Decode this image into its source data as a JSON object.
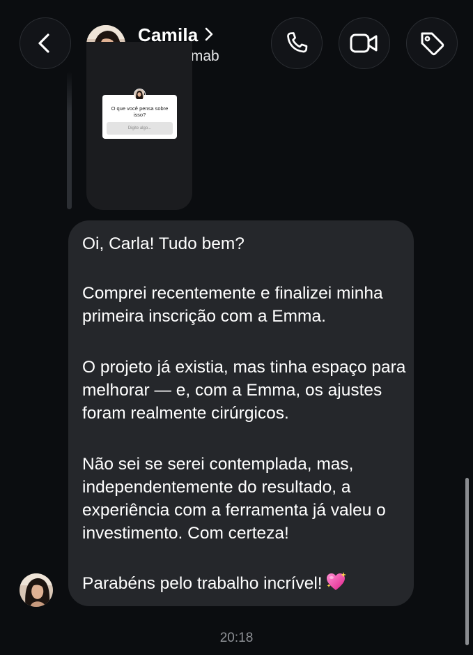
{
  "header": {
    "contact_name": "Camila",
    "username": "camila.limab",
    "icons": {
      "back": "chevron-left-icon",
      "call": "phone-icon",
      "video": "video-camera-icon",
      "tag": "tag-icon",
      "profile_link": "chevron-right-icon"
    }
  },
  "story_reply": {
    "question": "O que você pensa sobre isso?",
    "answer_placeholder": "Digite algo..."
  },
  "message": {
    "paragraphs": [
      "Oi, Carla! Tudo bem?",
      "Comprei recentemente e finalizei minha primeira inscrição com a Emma.",
      "O projeto já existia, mas tinha espaço para melhorar — e, com a Emma, os ajustes foram realmente cirúrgicos.",
      "Não sei se serei contemplada, mas, independentemente do resultado, a experiência com a ferramenta já valeu o investimento. Com certeza!",
      "Parabéns pelo trabalho incrível!"
    ],
    "emoji": "sparkling-heart-icon",
    "timestamp": "20:18"
  },
  "colors": {
    "background": "#0b0d10",
    "bubble": "#25272b",
    "button_bg": "#121418",
    "button_border": "#2b2e33",
    "timestamp": "#8e9196"
  }
}
